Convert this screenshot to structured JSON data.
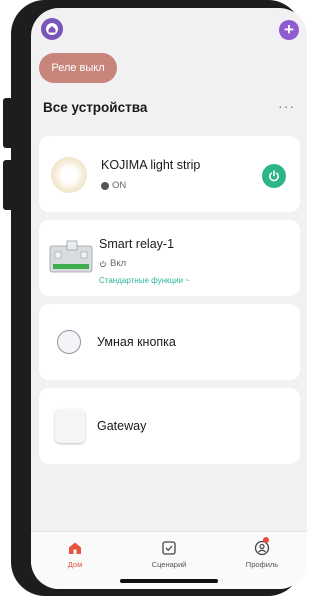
{
  "header": {
    "home_icon": "home-avatar-icon",
    "add_icon": "plus-icon",
    "add_label": "+"
  },
  "scenes": {
    "chip_label": "Реле выкл"
  },
  "section": {
    "title": "Все устройства",
    "more_label": "···"
  },
  "devices": [
    {
      "name": "KOJIMA light strip",
      "status": "ON",
      "icon": "light-strip-icon",
      "power_icon": "power-icon",
      "power_color": "#2db589"
    },
    {
      "name": "Smart relay-1",
      "status": "Вкл",
      "functions_label": "Стандартные функции ~",
      "icon": "relay-icon"
    },
    {
      "name": "Умная кнопка",
      "icon": "smart-button-icon"
    },
    {
      "name": "Gateway",
      "icon": "gateway-icon"
    }
  ],
  "tabbar": {
    "tabs": [
      {
        "label": "Дом",
        "icon": "home-icon",
        "active": true
      },
      {
        "label": "Сценарий",
        "icon": "scenario-icon",
        "active": false
      },
      {
        "label": "Профиль",
        "icon": "profile-icon",
        "active": false
      }
    ]
  },
  "colors": {
    "accent": "#e4533f",
    "scene_chip": "#c7857c",
    "add_button": "#8e5bd0",
    "power_on": "#2db589",
    "functions_link": "#2bb59a"
  }
}
